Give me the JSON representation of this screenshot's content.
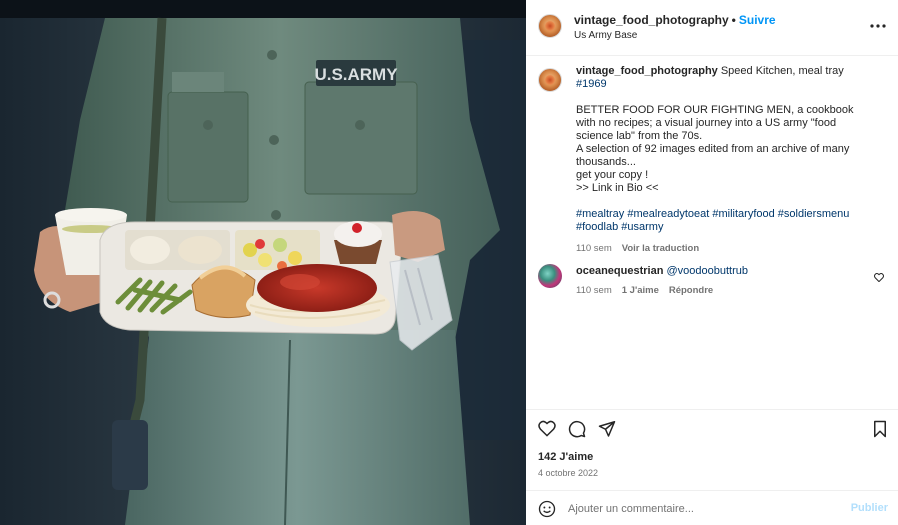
{
  "post": {
    "username": "vintage_food_photography",
    "separator": "•",
    "follow_label": "Suivre",
    "location": "Us Army Base",
    "photo": {
      "description_icon": "photo-soldier-meal-tray",
      "badge_text": "U.S.ARMY"
    }
  },
  "caption": {
    "username": "vintage_food_photography",
    "title": "Speed Kitchen, meal tray ",
    "title_tag": "#1969",
    "line1": "BETTER FOOD FOR OUR FIGHTING MEN, a cookbook with no recipes; a visual journey into a US army \"food science lab\" from the 70s.",
    "line2": "A selection of 92 images edited from an archive of many thousands...",
    "line3": "get your copy !",
    "line4": ">> Link in Bio <<",
    "hashtags": [
      "#mealtray",
      "#mealreadytoeat",
      "#militaryfood",
      "#soldiersmenu",
      "#foodlab",
      "#usarmy"
    ],
    "time": "110 sem",
    "translate_label": "Voir la traduction"
  },
  "comments": [
    {
      "username": "oceanequestrian",
      "mention": "@voodoobuttrub",
      "time": "110 sem",
      "likes": "1 J'aime",
      "reply_label": "Répondre"
    }
  ],
  "footer": {
    "likes": "142 J'aime",
    "date": "4 octobre 2022",
    "comment_placeholder": "Ajouter un commentaire...",
    "comment_value": "",
    "publish_label": "Publier"
  },
  "colors": {
    "follow_blue": "#0095f6",
    "link_blue": "#00376b",
    "publish_disabled": "#b2dffc",
    "muted": "#737373"
  },
  "icons": [
    "more-icon",
    "heart-icon",
    "comment-icon",
    "share-icon",
    "bookmark-icon",
    "emoji-icon",
    "small-heart-icon"
  ]
}
